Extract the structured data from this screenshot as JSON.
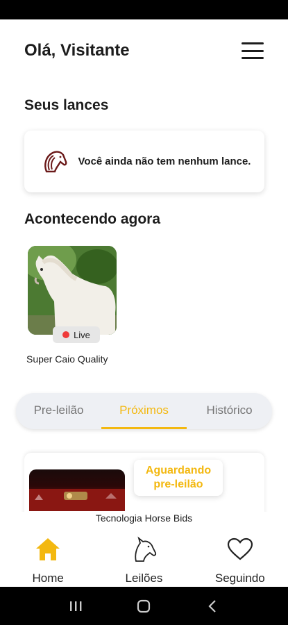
{
  "header": {
    "greeting": "Olá, Visitante"
  },
  "bids": {
    "title": "Seus lances",
    "empty_message": "Você ainda não tem nenhum lance."
  },
  "now": {
    "title": "Acontecendo agora",
    "items": [
      {
        "name": "Super Caio Quality",
        "badge": "Live"
      }
    ]
  },
  "tabs": [
    {
      "label": "Pre-leilão",
      "active": false
    },
    {
      "label": "Próximos",
      "active": true
    },
    {
      "label": "Histórico",
      "active": false
    }
  ],
  "auction": {
    "status": "Aguardando pre-leilão"
  },
  "footer": {
    "text": "Tecnologia Horse Bids"
  },
  "bottom_nav": [
    {
      "label": "Home",
      "icon": "home-icon"
    },
    {
      "label": "Leilões",
      "icon": "horse-icon"
    },
    {
      "label": "Seguindo",
      "icon": "heart-icon"
    }
  ],
  "colors": {
    "accent": "#f3b810",
    "live": "#ef3b3b",
    "tab_bg": "#eef0f4"
  }
}
